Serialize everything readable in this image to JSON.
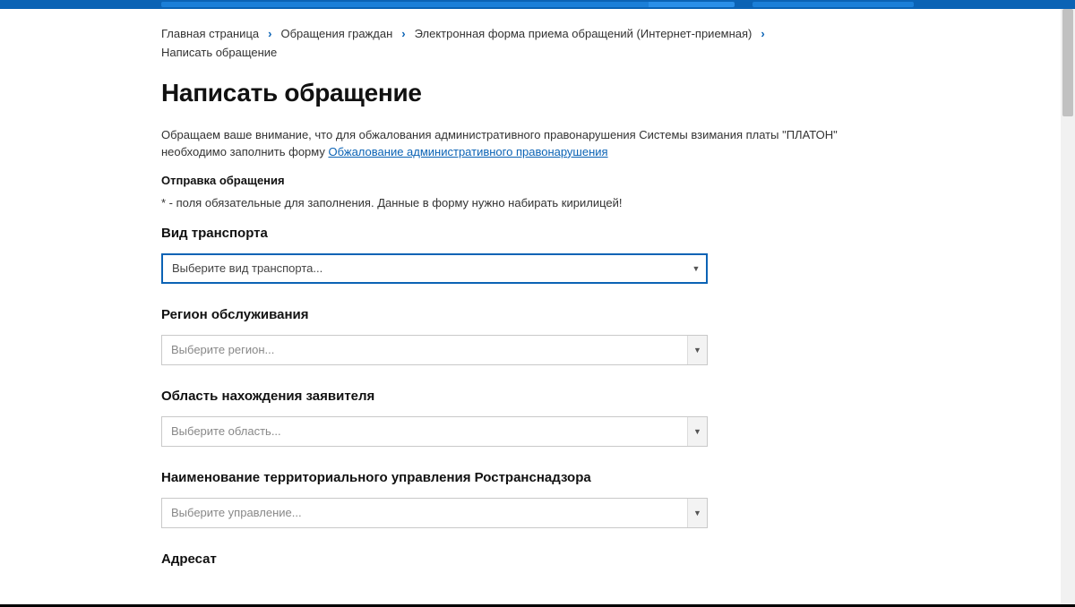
{
  "breadcrumb": {
    "items": [
      "Главная страница",
      "Обращения граждан",
      "Электронная форма приема обращений (Интернет-приемная)",
      "Написать обращение"
    ]
  },
  "page_title": "Написать обращение",
  "notice": {
    "prefix": "Обращаем ваше внимание, что для обжалования административного правонарушения Системы взимания платы \"ПЛАТОН\" необходимо заполнить форму ",
    "link_text": "Обжалование административного правонарушения"
  },
  "send_heading": "Отправка обращения",
  "required_note": "* - поля обязательные для заполнения. Данные в форму нужно набирать кирилицей!",
  "fields": {
    "transport": {
      "label": "Вид транспорта",
      "placeholder": "Выберите вид транспорта..."
    },
    "region": {
      "label": "Регион обслуживания",
      "placeholder": "Выберите регион..."
    },
    "oblast": {
      "label": "Область нахождения заявителя",
      "placeholder": "Выберите область..."
    },
    "department": {
      "label": "Наименование территориального управления Ространснадзора",
      "placeholder": "Выберите управление..."
    },
    "recipient": {
      "label": "Адресат"
    }
  }
}
